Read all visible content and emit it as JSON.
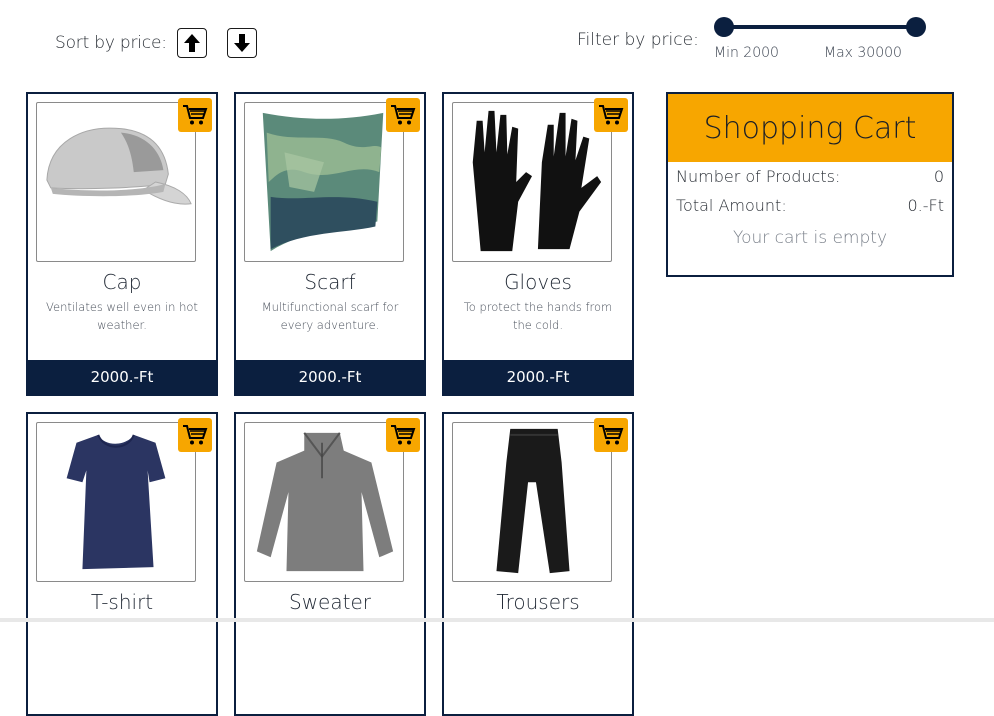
{
  "sort": {
    "label": "Sort by price:",
    "asc_icon": "arrow-up-icon",
    "desc_icon": "arrow-down-icon"
  },
  "filter": {
    "label": "Filter by price:",
    "min_label": "Min 2000",
    "max_label": "Max 30000",
    "min_value": 2000,
    "max_value": 30000
  },
  "products": [
    {
      "name": "Cap",
      "desc": "Ventilates well even in hot weather.",
      "price": "2000.-Ft",
      "image": "cap-image"
    },
    {
      "name": "Scarf",
      "desc": "Multifunctional scarf for every adventure.",
      "price": "2000.-Ft",
      "image": "scarf-image"
    },
    {
      "name": "Gloves",
      "desc": "To protect the hands from the cold.",
      "price": "2000.-Ft",
      "image": "gloves-image"
    },
    {
      "name": "T-shirt",
      "desc": "",
      "price": "",
      "image": "tshirt-image"
    },
    {
      "name": "Sweater",
      "desc": "",
      "price": "",
      "image": "sweater-image"
    },
    {
      "name": "Trousers",
      "desc": "",
      "price": "",
      "image": "trousers-image"
    }
  ],
  "cart": {
    "title": "Shopping Cart",
    "count_label": "Number of Products:",
    "count_value": "0",
    "total_label": "Total Amount:",
    "total_value": "0.-Ft",
    "empty_text": "Your cart is empty"
  },
  "colors": {
    "navy": "#0b1f3f",
    "accent": "#f7a600"
  }
}
